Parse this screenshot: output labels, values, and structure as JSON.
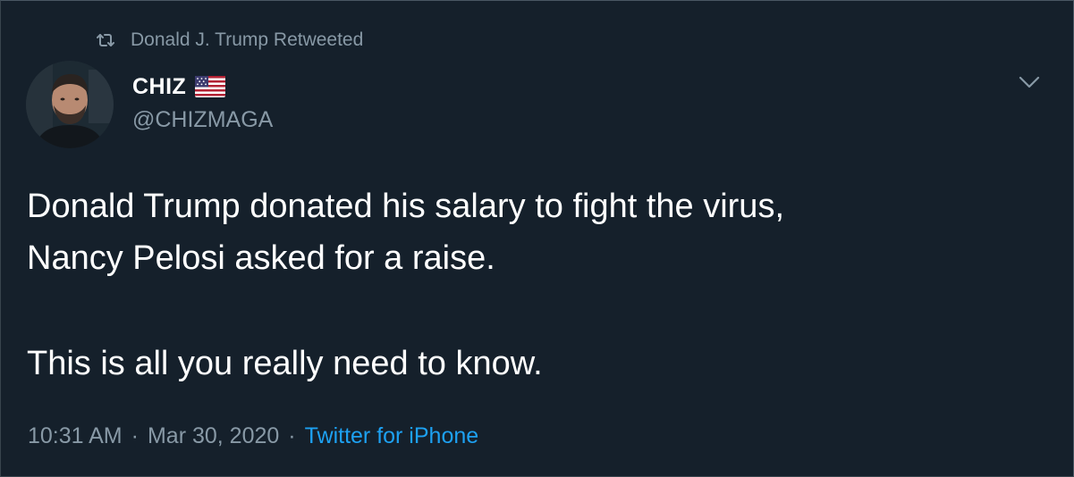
{
  "retweet_header": {
    "label": "Donald J. Trump Retweeted",
    "icon": "retweet-icon"
  },
  "author": {
    "display_name": "CHIZ",
    "flag_icon": "us-flag-icon",
    "handle": "@CHIZMAGA"
  },
  "tweet": {
    "line1": "Donald Trump donated his salary to fight the virus,",
    "line2": "Nancy Pelosi asked for a raise.",
    "line3": "This is all you really need to know."
  },
  "meta": {
    "time": "10:31 AM",
    "separator": "·",
    "date": "Mar 30, 2020",
    "source": "Twitter for iPhone"
  },
  "colors": {
    "background": "#15202b",
    "secondary_text": "#8899a6",
    "link": "#1da1f2",
    "primary_text": "#ffffff"
  }
}
